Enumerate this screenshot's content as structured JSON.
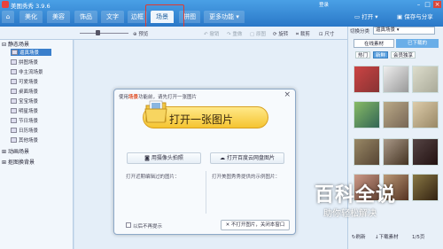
{
  "app": {
    "title": "美图秀秀 3.9.6"
  },
  "titlebar": {
    "login": "登录",
    "tabs": [
      {
        "label": "美化"
      },
      {
        "label": "美容"
      },
      {
        "label": "饰品"
      },
      {
        "label": "文字"
      },
      {
        "label": "边框"
      },
      {
        "label": "场景"
      },
      {
        "label": "拼图"
      },
      {
        "label": "更多功能 ▾"
      }
    ],
    "active_tab": "场景",
    "open_label": "打开",
    "save_label": "保存与分享"
  },
  "toolbar": {
    "preview": "预览",
    "undo": "撤销",
    "redo": "重做",
    "original": "原图",
    "rotate": "旋转",
    "crop": "裁剪",
    "size": "尺寸"
  },
  "left_panel": {
    "static_scene": "静态场景",
    "items": [
      {
        "label": "逼真场景"
      },
      {
        "label": "拼图场景"
      },
      {
        "label": "非主流场景"
      },
      {
        "label": "可爱场景"
      },
      {
        "label": "桌面场景"
      },
      {
        "label": "宝宝场景"
      },
      {
        "label": "明星场景"
      },
      {
        "label": "节日场景"
      },
      {
        "label": "日历场景"
      },
      {
        "label": "其他场景"
      }
    ],
    "dynamic_scene": "动画场景",
    "cutout_bg": "抠图换背景"
  },
  "dialog": {
    "title_prefix": "使用",
    "title_highlight": "场景",
    "title_suffix": "功能前，请先打开一张图片",
    "main_button": "打开一张图片",
    "camera_button": "用摄像头拍照",
    "cloud_button": "打开百度云网盘图片",
    "recent_note": "打开近期编辑过的图片：",
    "sample_note": "打开美图秀秀提供的示例图片：",
    "checkbox_label": "以后不再提示",
    "close_button": "不打开图片，关闭本窗口"
  },
  "right_panel": {
    "category_label": "切换分类",
    "category_value": "逼真场景",
    "tab_online": "在线素材",
    "tab_downloaded": "已下载的",
    "chips": [
      {
        "label": "热门"
      },
      {
        "label": "新鲜"
      },
      {
        "label": "会员独享"
      }
    ],
    "bottom_refresh": "刷新",
    "bottom_download": "下载素材",
    "bottom_page": "1/5页"
  },
  "watermark": {
    "title": "百科全说",
    "subtitle": "助你轻松解决"
  },
  "colors": {
    "titlebar": "#2a78c8",
    "highlight_box": "#e23a2e",
    "main_button": "#f5c430"
  }
}
